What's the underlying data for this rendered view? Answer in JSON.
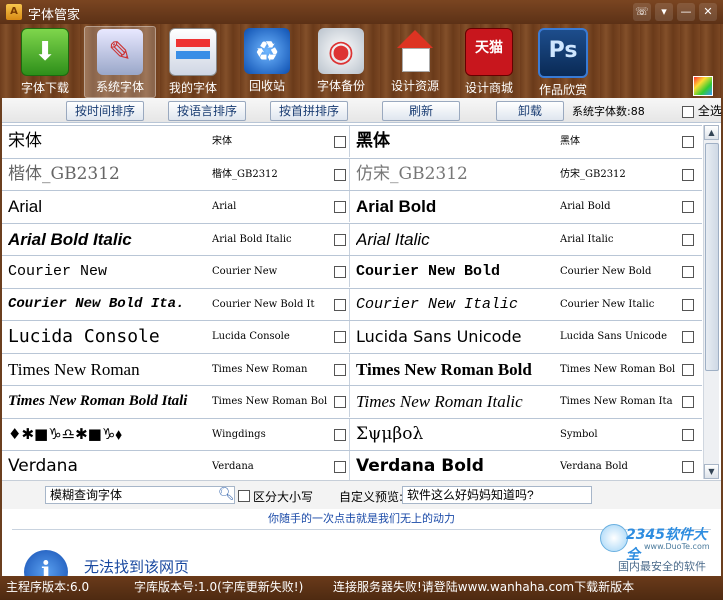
{
  "window": {
    "title": "字体管家",
    "icon": "app-logo-icon"
  },
  "toolbar": {
    "items": [
      {
        "label": "字体下载",
        "icon": "download-icon",
        "active": false
      },
      {
        "label": "系统字体",
        "icon": "brush-easel-icon",
        "active": true
      },
      {
        "label": "我的字体",
        "icon": "font-box-icon",
        "active": false
      },
      {
        "label": "回收站",
        "icon": "recycle-icon",
        "active": false
      },
      {
        "label": "字体备份",
        "icon": "disc-backup-icon",
        "active": false
      },
      {
        "label": "设计资源",
        "icon": "house-icon",
        "active": false
      },
      {
        "label": "设计商城",
        "icon": "tmall-icon",
        "active": false
      },
      {
        "label": "作品欣赏",
        "icon": "photoshop-icon",
        "active": false
      }
    ],
    "skin_icon": "skin-palette-icon"
  },
  "actions": {
    "sort_time": "按时间排序",
    "sort_lang": "按语言排序",
    "sort_pinyin": "按首拼排序",
    "refresh": "刷新",
    "uninstall": "卸载",
    "count_label": "系统字体数:88",
    "select_all": "全选"
  },
  "fonts": [
    {
      "left_sample": "宋体",
      "left_name": "宋体",
      "right_sample": "黑体",
      "right_name": "黑体"
    },
    {
      "left_sample": "楷体_GB2312",
      "left_name": "楷体_GB2312",
      "right_sample": "仿宋_GB2312",
      "right_name": "仿宋_GB2312"
    },
    {
      "left_sample": "Arial",
      "left_name": "Arial",
      "right_sample": "Arial Bold",
      "right_name": "Arial Bold"
    },
    {
      "left_sample": "Arial Bold Italic",
      "left_name": "Arial Bold Italic",
      "right_sample": "Arial Italic",
      "right_name": "Arial Italic"
    },
    {
      "left_sample": "Courier New",
      "left_name": "Courier New",
      "right_sample": "Courier New Bold",
      "right_name": "Courier New Bold"
    },
    {
      "left_sample": "Courier New Bold Ita.",
      "left_name": "Courier New Bold It",
      "right_sample": "Courier New Italic",
      "right_name": "Courier New Italic"
    },
    {
      "left_sample": "Lucida Console",
      "left_name": "Lucida Console",
      "right_sample": "Lucida Sans Unicode",
      "right_name": "Lucida Sans Unicode"
    },
    {
      "left_sample": "Times New Roman",
      "left_name": "Times New Roman",
      "right_sample": "Times New Roman Bold",
      "right_name": "Times New Roman Bol"
    },
    {
      "left_sample": "Times New Roman Bold Itali",
      "left_name": "Times New Roman Bol",
      "right_sample": "Times New Roman Italic",
      "right_name": "Times New Roman Ita"
    },
    {
      "left_sample": "♦✱■♑♎✱■♑⬧",
      "left_name": "Wingdings",
      "right_sample": "Σψμβολ",
      "right_name": "Symbol"
    },
    {
      "left_sample": "Verdana",
      "left_name": "Verdana",
      "right_sample": "Verdana Bold",
      "right_name": "Verdana Bold"
    }
  ],
  "search": {
    "value": "模糊查询字体",
    "icon": "search-icon",
    "case_label": "区分大小写",
    "preview_label": "自定义预览:",
    "preview_value": "软件这么好妈妈知道吗?"
  },
  "slogan": "你随手的一次点击就是我们无上的动力",
  "web": {
    "icon": "info-icon",
    "message": "无法找到该网页"
  },
  "watermark": {
    "brand": "2345软件大全",
    "url": "www.DuoTe.com",
    "tagline": "国内最安全的软件站"
  },
  "status": {
    "main_version": "主程序版本:6.0",
    "lib_version": "字库版本号:1.0(字库更新失败!)",
    "server": "连接服务器失败!请登陆www.wanhaha.com下载新版本"
  },
  "colors": {
    "frame": "#6b3f1f",
    "link": "#1a49a0",
    "grid_line": "#b9c6d6"
  }
}
